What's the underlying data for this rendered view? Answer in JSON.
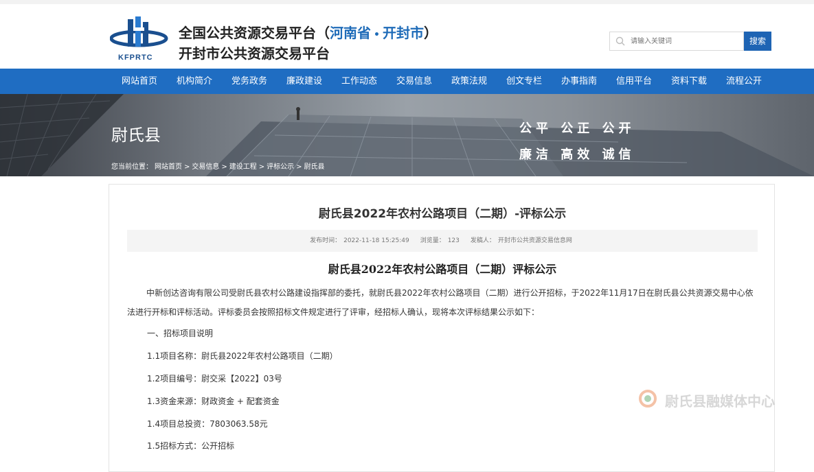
{
  "header": {
    "logo_text": "KFPRTC",
    "title_prefix": "全国公共资源交易平台（",
    "title_province": "河南省",
    "title_dot": "•",
    "title_city": "开封市",
    "title_suffix": "）",
    "subtitle": "开封市公共资源交易平台",
    "search_placeholder": "请输入关键词",
    "search_button": "搜索"
  },
  "nav": {
    "items": [
      "网站首页",
      "机构简介",
      "党务政务",
      "廉政建设",
      "工作动态",
      "交易信息",
      "政策法规",
      "创文专栏",
      "办事指南",
      "信用平台",
      "资料下载",
      "流程公开"
    ]
  },
  "banner": {
    "title": "尉氏县",
    "slogan_line1": "公平 公正 公开",
    "slogan_line2": "廉洁 高效 诚信",
    "breadcrumb": [
      "您当前位置：",
      "网站首页",
      ">",
      "交易信息",
      ">",
      "建设工程",
      ">",
      "评标公示",
      ">",
      "尉氏县"
    ]
  },
  "article": {
    "title": "尉氏县2022年农村公路项目（二期）-评标公示",
    "publish_label": "发布时间：",
    "publish_time": "2022-11-18 15:25:49",
    "views_label": "浏览量：",
    "views": "123",
    "author_label": "发稿人：",
    "author": "开封市公共资源交易信息网",
    "doc_title": "尉氏县2022年农村公路项目（二期）评标公示",
    "paragraph": "中新创达咨询有限公司受尉氏县农村公路建设指挥部的委托，就尉氏县2022年农村公路项目（二期）进行公开招标，于2022年11月17日在尉氏县公共资源交易中心依法进行开标和评标活动。评标委员会按照招标文件规定进行了评审，经招标人确认，现将本次评标结果公示如下：",
    "section1": "一、招标项目说明",
    "item1": "1.1项目名称：尉氏县2022年农村公路项目（二期）",
    "item2": "1.2项目编号：尉交采【2022】03号",
    "item3": "1.3资金来源：财政资金 + 配套资金",
    "item4": "1.4项目总投资：7803063.58元",
    "item5": "1.5招标方式：公开招标"
  },
  "watermark": {
    "text": "尉氏县融媒体中心"
  },
  "colors": {
    "nav_bg": "#1f6dc2",
    "accent": "#1e6bb8",
    "search_btn": "#1e64b4"
  }
}
